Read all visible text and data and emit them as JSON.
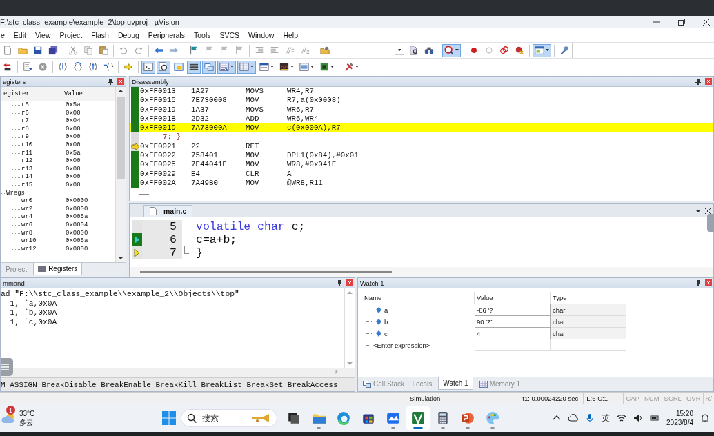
{
  "window": {
    "title": "F:\\stc_class_example\\example_2\\top.uvproj - µVision"
  },
  "menu": [
    "e",
    "Edit",
    "View",
    "Project",
    "Flash",
    "Debug",
    "Peripherals",
    "Tools",
    "SVCS",
    "Window",
    "Help"
  ],
  "toolbar": [
    {
      "kind": "new-file",
      "on": false
    },
    {
      "kind": "open",
      "on": false
    },
    {
      "kind": "save",
      "on": false
    },
    {
      "kind": "save-all",
      "on": false
    },
    {
      "kind": "separator"
    },
    {
      "kind": "cut",
      "on": false
    },
    {
      "kind": "copy",
      "on": false
    },
    {
      "kind": "paste",
      "on": false
    },
    {
      "kind": "separator"
    },
    {
      "kind": "undo",
      "on": false
    },
    {
      "kind": "redo",
      "on": false
    },
    {
      "kind": "separator"
    },
    {
      "kind": "nav-back",
      "on": false
    },
    {
      "kind": "nav-forward",
      "on": false
    },
    {
      "kind": "separator"
    },
    {
      "kind": "bookmark",
      "on": false
    },
    {
      "kind": "bookmark-prev",
      "on": false
    },
    {
      "kind": "bookmark-next",
      "on": false
    },
    {
      "kind": "bookmark-clear",
      "on": false
    },
    {
      "kind": "separator"
    },
    {
      "kind": "indent",
      "on": false
    },
    {
      "kind": "unindent",
      "on": false
    },
    {
      "kind": "comment",
      "on": false
    },
    {
      "kind": "uncomment",
      "on": false
    },
    {
      "kind": "separator"
    },
    {
      "kind": "configure",
      "on": false
    },
    {
      "kind": "find-combo"
    },
    {
      "kind": "find-doc",
      "on": false
    },
    {
      "kind": "incremental-find",
      "on": false
    },
    {
      "kind": "separator"
    },
    {
      "kind": "debug",
      "on": true
    },
    {
      "kind": "separator"
    },
    {
      "kind": "bp-insert",
      "on": false
    },
    {
      "kind": "bp-enable",
      "on": false
    },
    {
      "kind": "bp-disable",
      "on": false
    },
    {
      "kind": "bp-kill",
      "on": false
    },
    {
      "kind": "separator"
    },
    {
      "kind": "window-layout",
      "on": true
    },
    {
      "kind": "separator"
    },
    {
      "kind": "wrench",
      "on": false
    }
  ],
  "debug_toolbar": [
    {
      "kind": "reset",
      "on": false
    },
    {
      "kind": "separator"
    },
    {
      "kind": "run",
      "on": false
    },
    {
      "kind": "stop",
      "on": false
    },
    {
      "kind": "separator"
    },
    {
      "kind": "step-into",
      "on": false
    },
    {
      "kind": "step-over",
      "on": false
    },
    {
      "kind": "step-out",
      "on": false
    },
    {
      "kind": "run-to-cursor",
      "on": false
    },
    {
      "kind": "separator"
    },
    {
      "kind": "show-next",
      "on": false
    },
    {
      "kind": "separator"
    },
    {
      "kind": "command-window",
      "on": true
    },
    {
      "kind": "disassembly-window",
      "on": true
    },
    {
      "kind": "symbols-window",
      "on": false
    },
    {
      "kind": "registers-window",
      "on": true
    },
    {
      "kind": "call-stack-window",
      "on": true
    },
    {
      "kind": "watch-window",
      "on": true
    },
    {
      "kind": "memory-window",
      "on": true
    },
    {
      "kind": "serial-window",
      "on": false
    },
    {
      "kind": "analysis-window",
      "on": false
    },
    {
      "kind": "trace-window",
      "on": false
    },
    {
      "kind": "system-viewer",
      "on": false
    },
    {
      "kind": "separator"
    },
    {
      "kind": "tools",
      "on": false
    }
  ],
  "registers": {
    "title": "egisters",
    "columns": [
      "egister",
      "Value"
    ],
    "items": [
      {
        "children": [
          {
            "name": "r5",
            "value": "0x5a"
          },
          {
            "name": "r6",
            "value": "0x00"
          },
          {
            "name": "r7",
            "value": "0x04"
          },
          {
            "name": "r8",
            "value": "0x00"
          },
          {
            "name": "r9",
            "value": "0x00"
          },
          {
            "name": "r10",
            "value": "0x00"
          },
          {
            "name": "r11",
            "value": "0x5a"
          },
          {
            "name": "r12",
            "value": "0x00"
          },
          {
            "name": "r13",
            "value": "0x00"
          },
          {
            "name": "r14",
            "value": "0x00"
          },
          {
            "name": "r15",
            "value": "0x00"
          }
        ]
      },
      {
        "name": "Wregs",
        "children": [
          {
            "name": "wr0",
            "value": "0x0000"
          },
          {
            "name": "wr2",
            "value": "0x0000"
          },
          {
            "name": "wr4",
            "value": "0x005a"
          },
          {
            "name": "wr6",
            "value": "0x0004"
          },
          {
            "name": "wr8",
            "value": "0x0000"
          },
          {
            "name": "wr10",
            "value": "0x005a"
          },
          {
            "name": "wr12",
            "value": "0x0000"
          }
        ]
      }
    ],
    "tabs": [
      {
        "label": "Project",
        "selected": false
      },
      {
        "label": "Registers",
        "selected": true
      }
    ]
  },
  "disassembly": {
    "title": "Disassembly",
    "rows": [
      {
        "kind": "instruction",
        "address": "0xFF0013",
        "opcode": "1A27",
        "mnemonic": "MOVS",
        "operands": "WR4,R7",
        "highlighted": false,
        "current": false
      },
      {
        "kind": "instruction",
        "address": "0xFF0015",
        "opcode": "7E730008",
        "mnemonic": "MOV",
        "operands": "R7,a(0x0008)",
        "highlighted": false,
        "current": false
      },
      {
        "kind": "instruction",
        "address": "0xFF0019",
        "opcode": "1A37",
        "mnemonic": "MOVS",
        "operands": "WR6,R7",
        "highlighted": false,
        "current": false
      },
      {
        "kind": "instruction",
        "address": "0xFF001B",
        "opcode": "2D32",
        "mnemonic": "ADD",
        "operands": "WR6,WR4",
        "highlighted": false,
        "current": false
      },
      {
        "kind": "instruction",
        "address": "0xFF001D",
        "opcode": "7A73000A",
        "mnemonic": "MOV",
        "operands": "c(0x000A),R7",
        "highlighted": true,
        "current": false
      },
      {
        "kind": "source",
        "text": "7: }"
      },
      {
        "kind": "instruction",
        "address": "0xFF0021",
        "opcode": "22",
        "mnemonic": "RET",
        "highlighted": false,
        "current": true
      },
      {
        "kind": "instruction",
        "address": "0xFF0022",
        "opcode": "758401",
        "mnemonic": "MOV",
        "operands": "DPL1(0x84),#0x01",
        "highlighted": false,
        "current": false
      },
      {
        "kind": "instruction",
        "address": "0xFF0025",
        "opcode": "7E44041F",
        "mnemonic": "MOV",
        "operands": "WR8,#0x041F",
        "highlighted": false,
        "current": false
      },
      {
        "kind": "instruction",
        "address": "0xFF0029",
        "opcode": "E4",
        "mnemonic": "CLR",
        "operands": "A",
        "highlighted": false,
        "current": false
      },
      {
        "kind": "instruction",
        "address": "0xFF002A",
        "opcode": "7A49B0",
        "mnemonic": "MOV",
        "operands": "@WR8,R11",
        "highlighted": false,
        "current": false
      }
    ]
  },
  "editor": {
    "tabs": [
      {
        "label": "main.c",
        "selected": true
      }
    ],
    "lines": [
      {
        "number": "5",
        "current": false,
        "return_point": false,
        "tokens": [
          {
            "kind": "keyword",
            "text": "volatile char"
          },
          {
            "kind": "plain",
            "text": " c;"
          }
        ]
      },
      {
        "number": "6",
        "current": true,
        "return_point": false,
        "tokens": [
          {
            "kind": "plain",
            "text": "c=a+b;"
          }
        ]
      },
      {
        "number": "7",
        "current": false,
        "return_point": true,
        "fold_end": true,
        "tokens": [
          {
            "kind": "plain",
            "text": "}"
          }
        ]
      }
    ]
  },
  "command": {
    "title": "mmand",
    "lines": [
      "ad \"F:\\\\stc_class_example\\\\example_2\\\\Objects\\\\top\"",
      "  1, `a,0x0A",
      "  1, `b,0x0A",
      "  1, `c,0x0A"
    ],
    "hint": "M ASSIGN BreakDisable BreakEnable BreakKill BreakList BreakSet BreakAccess"
  },
  "watch": {
    "title": "Watch 1",
    "columns": [
      "Name",
      "Value",
      "Type"
    ],
    "rows": [
      {
        "name": "a",
        "value": "-86 '?",
        "type": "char"
      },
      {
        "name": "b",
        "value": "90 'Z'",
        "type": "char"
      },
      {
        "name": "c",
        "value": "4",
        "type": "char"
      }
    ],
    "new_row": "<Enter expression>",
    "tabs": [
      {
        "label": "Call Stack + Locals",
        "selected": false
      },
      {
        "label": "Watch 1",
        "selected": true
      },
      {
        "label": "Memory 1",
        "selected": false
      }
    ]
  },
  "status_bar": {
    "mode": "Simulation",
    "timer": "t1: 0.00024220 sec",
    "position": "L:6 C:1",
    "indicators": [
      {
        "label": "CAP",
        "on": false
      },
      {
        "label": "NUM",
        "on": false
      },
      {
        "label": "SCRL",
        "on": false
      },
      {
        "label": "OVR",
        "on": false
      },
      {
        "label": "R/",
        "on": false
      }
    ]
  },
  "taskbar": {
    "weather": {
      "temperature": "33°C",
      "condition": "多云",
      "badge": "1"
    },
    "search": {
      "label": "搜索"
    },
    "apps": [
      {
        "kind": "task-view",
        "running": false,
        "active": false
      },
      {
        "kind": "file-explorer",
        "running": true,
        "active": false
      },
      {
        "kind": "browser",
        "running": false,
        "active": false
      },
      {
        "kind": "store",
        "running": false,
        "active": false
      },
      {
        "kind": "meeting",
        "running": true,
        "active": false
      },
      {
        "kind": "keil",
        "running": true,
        "active": true
      },
      {
        "kind": "calculator",
        "running": true,
        "active": false
      },
      {
        "kind": "slides",
        "running": true,
        "active": false
      },
      {
        "kind": "paint",
        "running": true,
        "active": false
      }
    ],
    "ime": "英",
    "time": "15:20",
    "date": "2023/8/4"
  }
}
